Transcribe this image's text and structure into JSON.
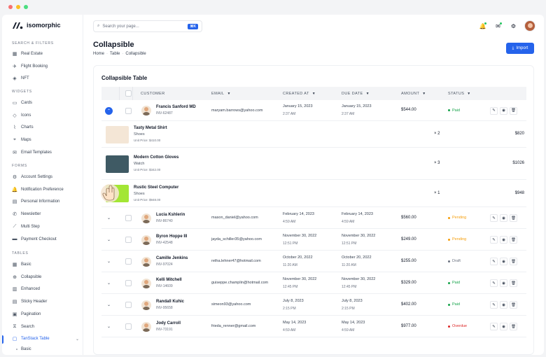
{
  "app": {
    "name": "isomorphic"
  },
  "sidebar": {
    "sections": [
      {
        "title": "SEARCH & FILTERS",
        "items": [
          {
            "label": "Real Estate",
            "icon": "building-icon"
          },
          {
            "label": "Flight Booking",
            "icon": "plane-icon"
          },
          {
            "label": "NFT",
            "icon": "nft-icon"
          }
        ]
      },
      {
        "title": "WIDGETS",
        "items": [
          {
            "label": "Cards",
            "icon": "card-icon"
          },
          {
            "label": "Icons",
            "icon": "shapes-icon"
          },
          {
            "label": "Charts",
            "icon": "chart-icon"
          },
          {
            "label": "Maps",
            "icon": "map-pin-icon"
          },
          {
            "label": "Email Templates",
            "icon": "envelope-icon"
          }
        ]
      },
      {
        "title": "FORMS",
        "items": [
          {
            "label": "Account Settings",
            "icon": "user-gear-icon"
          },
          {
            "label": "Notification Preference",
            "icon": "bell-icon"
          },
          {
            "label": "Personal Information",
            "icon": "id-card-icon"
          },
          {
            "label": "Newsletter",
            "icon": "newsletter-icon"
          },
          {
            "label": "Multi Step",
            "icon": "steps-icon"
          },
          {
            "label": "Payment Checkout",
            "icon": "credit-card-icon"
          }
        ]
      },
      {
        "title": "TABLES",
        "items": [
          {
            "label": "Basic",
            "icon": "grid-icon"
          },
          {
            "label": "Collapsible",
            "icon": "collapse-icon"
          },
          {
            "label": "Enhanced",
            "icon": "table-icon"
          },
          {
            "label": "Sticky Header",
            "icon": "sticky-icon"
          },
          {
            "label": "Pagination",
            "icon": "pagination-icon"
          },
          {
            "label": "Search",
            "icon": "filter-icon"
          },
          {
            "label": "TanStack Table",
            "icon": "tanstack-icon",
            "active": true
          }
        ]
      }
    ],
    "sub_item": "Basic"
  },
  "header": {
    "search_placeholder": "Search your page...",
    "search_shortcut": "⌘K"
  },
  "page": {
    "title": "Collapsible",
    "breadcrumb": [
      "Home",
      "Table",
      "Collapsible"
    ],
    "import_label": "Import"
  },
  "table": {
    "title": "Collapsible Table",
    "columns": [
      "CUSTOMER",
      "EMAIL",
      "CREATED AT",
      "DUE DATE",
      "AMOUNT",
      "STATUS"
    ],
    "rows": [
      {
        "name": "Francis Sanford MD",
        "invoice": "INV-62487",
        "email": "maryam.barrows@yahoo.com",
        "created_date": "January 15, 2023",
        "created_time": "2:37 AM",
        "due_date": "January 15, 2023",
        "due_time": "2:37 AM",
        "amount": "$544.00",
        "status": "Paid",
        "status_color": "#16a34a",
        "expanded": true
      },
      {
        "name": "Lucia Kshlerin",
        "invoice": "INV-86740",
        "email": "mason_daniel@yahoo.com",
        "created_date": "February 14, 2023",
        "created_time": "4:59 AM",
        "due_date": "February 14, 2023",
        "due_time": "4:59 AM",
        "amount": "$560.00",
        "status": "Pending",
        "status_color": "#f59e0b"
      },
      {
        "name": "Byron Hoppe III",
        "invoice": "INV-42548",
        "email": "jayda_schiller35@yahoo.com",
        "created_date": "November 30, 2022",
        "created_time": "12:51 PM",
        "due_date": "November 30, 2022",
        "due_time": "12:51 PM",
        "amount": "$249.00",
        "status": "Pending",
        "status_color": "#f59e0b"
      },
      {
        "name": "Camille Jenkins",
        "invoice": "INV-97024",
        "email": "retha.lehner47@hotmail.com",
        "created_date": "October 20, 2022",
        "created_time": "11:20 AM",
        "due_date": "October 20, 2022",
        "due_time": "11:20 AM",
        "amount": "$255.00",
        "status": "Draft",
        "status_color": "#6b7280"
      },
      {
        "name": "Kelli Mitchell",
        "invoice": "INV-14609",
        "email": "guiseppe.champlin@hotmail.com",
        "created_date": "November 30, 2022",
        "created_time": "12:45 PM",
        "due_date": "November 30, 2022",
        "due_time": "12:45 PM",
        "amount": "$329.00",
        "status": "Paid",
        "status_color": "#16a34a"
      },
      {
        "name": "Randall Kuhic",
        "invoice": "INV-95658",
        "email": "simeon93@yahoo.com",
        "created_date": "July 8, 2023",
        "created_time": "2:15 PM",
        "due_date": "July 8, 2023",
        "due_time": "2:15 PM",
        "amount": "$402.00",
        "status": "Paid",
        "status_color": "#16a34a"
      },
      {
        "name": "Jody Carroll",
        "invoice": "INV-73191",
        "email": "frieda_renner@gmail.com",
        "created_date": "May 14, 2023",
        "created_time": "4:59 AM",
        "due_date": "May 14, 2023",
        "due_time": "4:59 AM",
        "amount": "$977.00",
        "status": "Overdue",
        "status_color": "#dc2626"
      }
    ],
    "products": [
      {
        "name": "Tasty Metal Shirt",
        "category": "Shoes",
        "unit_price": "Unit Price: $410.00",
        "qty": "× 2",
        "total": "$820",
        "image_color": "#f4e6d6"
      },
      {
        "name": "Modern Cotton Gloves",
        "category": "Watch",
        "unit_price": "Unit Price: $342.00",
        "qty": "× 3",
        "total": "$1026",
        "image_color": "#3f5a64"
      },
      {
        "name": "Rustic Steel Computer",
        "category": "Shoes",
        "unit_price": "Unit Price: $948.00",
        "qty": "× 1",
        "total": "$948",
        "image_color": "#a3e635"
      }
    ]
  }
}
